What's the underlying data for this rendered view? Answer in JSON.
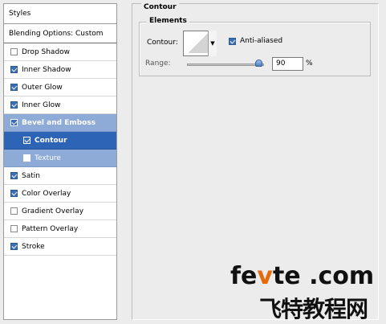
{
  "left_panel": {
    "styles_label": "Styles",
    "blending_label": "Blending Options: Custom",
    "items": [
      {
        "label": "Drop Shadow",
        "checked": false
      },
      {
        "label": "Inner Shadow",
        "checked": true
      },
      {
        "label": "Outer Glow",
        "checked": true
      },
      {
        "label": "Inner Glow",
        "checked": true
      },
      {
        "label": "Bevel and Emboss",
        "checked": true
      },
      {
        "label": "Contour",
        "checked": true
      },
      {
        "label": "Texture",
        "checked": false
      },
      {
        "label": "Satin",
        "checked": true
      },
      {
        "label": "Color Overlay",
        "checked": true
      },
      {
        "label": "Gradient Overlay",
        "checked": false
      },
      {
        "label": "Pattern Overlay",
        "checked": false
      },
      {
        "label": "Stroke",
        "checked": true
      }
    ]
  },
  "right_panel": {
    "section_title": "Contour",
    "group_title": "Elements",
    "contour_label": "Contour:",
    "anti_aliased_label": "Anti-aliased",
    "anti_aliased_checked": true,
    "range_label": "Range:",
    "range_value": "90",
    "range_unit": "%",
    "range_fraction": 0.9
  },
  "watermark": {
    "line1_pre": "fe",
    "line1_v": "v",
    "line1_post": "te .com",
    "line2": "飞特教程网"
  },
  "colors": {
    "selected_bg": "#2e64b5",
    "group_bg": "#8eaad6",
    "watermark_accent": "#e46a0c"
  }
}
